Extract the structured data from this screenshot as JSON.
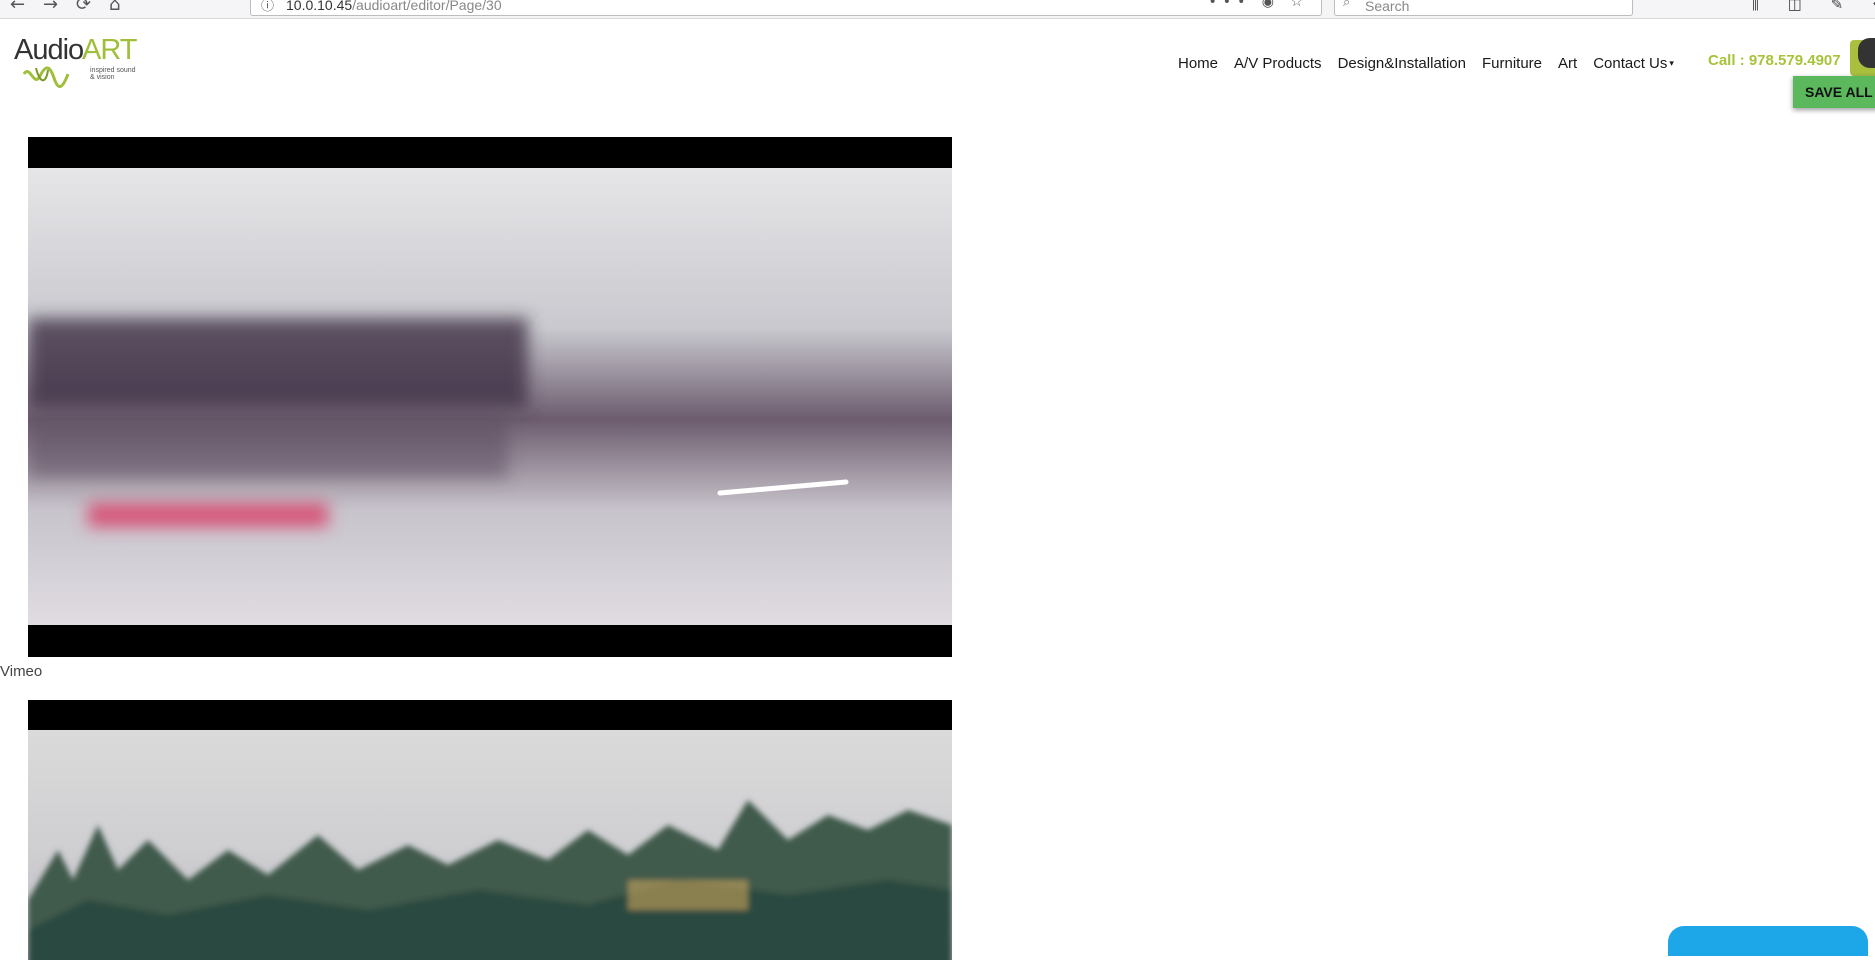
{
  "browser": {
    "url_host": "10.0.10.45",
    "url_path": "/audioart/editor/Page/30",
    "search_placeholder": "Search",
    "back_icon": "←",
    "forward_icon": "→",
    "reload_icon": "⟳",
    "home_icon": "⌂",
    "info_icon": "ⓘ",
    "page_actions": "••• ◉ ☆",
    "search_glyph": "⌕",
    "toolbar_glyphs": "⫼ ◫ ✎ ❖"
  },
  "site": {
    "logo_audio": "Audio",
    "logo_art": "ART",
    "logo_tagline_1": "inspired sound",
    "logo_tagline_2": "& vision",
    "nav": [
      {
        "label": "Home"
      },
      {
        "label": "A/V Products"
      },
      {
        "label": "Design&Installation"
      },
      {
        "label": "Furniture"
      },
      {
        "label": "Art"
      },
      {
        "label": "Contact Us",
        "caret": "▾"
      }
    ],
    "call": "Call : 978.579.4907",
    "save_all": "SAVE ALL"
  },
  "content": {
    "video_caption": "Vimeo"
  },
  "colors": {
    "accent_green": "#a7c33a",
    "save_button": "#5cb85c",
    "chat_blue": "#1ea7e8"
  }
}
